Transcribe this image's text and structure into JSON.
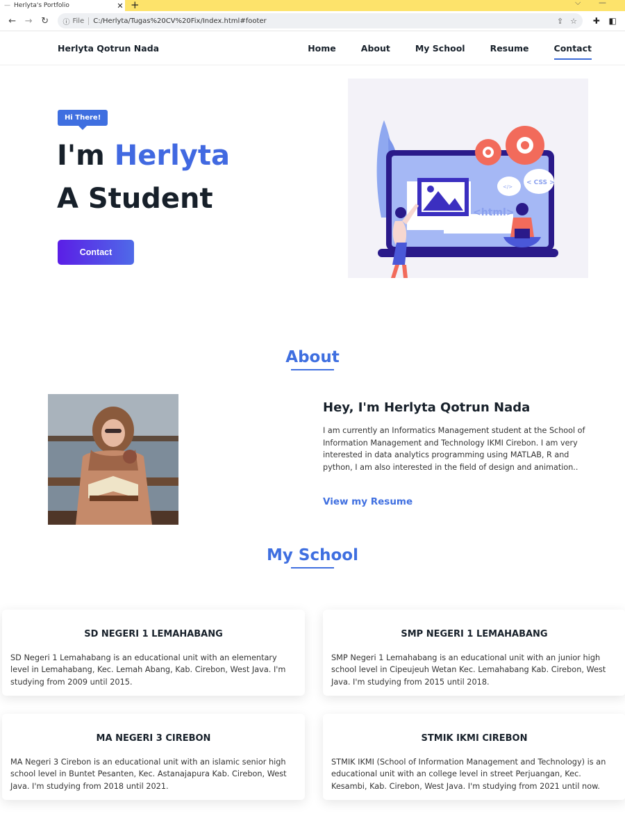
{
  "browser": {
    "tab_title": "Herlyta's Portfolio",
    "scheme_label": "File",
    "url": "C:/Herlyta/Tugas%20CV%20Fix/Index.html#footer"
  },
  "nav": {
    "brand": "Herlyta Qotrun Nada",
    "links": [
      "Home",
      "About",
      "My School",
      "Resume",
      "Contact"
    ],
    "active": "Contact"
  },
  "hero": {
    "badge": "Hi There!",
    "greeting": "I'm",
    "name": "Herlyta",
    "role": "A Student",
    "button": "Contact",
    "illustration_labels": {
      "html": "<html>",
      "css": "< CSS >",
      "code": "</>"
    }
  },
  "about": {
    "title": "About",
    "heading": "Hey, I'm Herlyta Qotrun Nada",
    "text": "I am currently an Informatics Management student at the School of Information Management and Technology IKMI Cirebon. I am very interested in data analytics programming using MATLAB, R and python, I am also interested in the field of design and animation..",
    "link": "View my Resume"
  },
  "school": {
    "title": "My School",
    "cards": [
      {
        "name": "SD NEGERI 1 LEMAHABANG",
        "desc": "SD Negeri 1 Lemahabang is an educational unit with an elementary level in Lemahabang, Kec. Lemah Abang, Kab. Cirebon, West Java. I'm studying from 2009 until 2015."
      },
      {
        "name": "SMP NEGERI 1 LEMAHABANG",
        "desc": "SMP Negeri 1 Lemahabang is an educational unit with an junior high school level in Cipeujeuh Wetan Kec. Lemahabang Kab. Cirebon, West Java. I'm studying from 2015 until 2018."
      },
      {
        "name": "MA NEGERI 3 CIREBON",
        "desc": "MA Negeri 3 Cirebon is an educational unit with an islamic senior high school level in Buntet Pesanten, Kec. Astanajapura Kab. Cirebon, West Java. I'm studying from 2018 until 2021."
      },
      {
        "name": "STMIK IKMI CIREBON",
        "desc": "STMIK IKMI (School of Information Management and Technology) is an educational unit with an college level in street Perjuangan, Kec. Kesambi, Kab. Cirebon, West Java. I'm studying from 2021 until now."
      }
    ]
  },
  "colors": {
    "accent": "#3f6fe0",
    "button_gradient_start": "#5b1ee6",
    "button_gradient_end": "#4f6ae8",
    "tab_strip": "#fde36b",
    "text_dark": "#17202a"
  }
}
